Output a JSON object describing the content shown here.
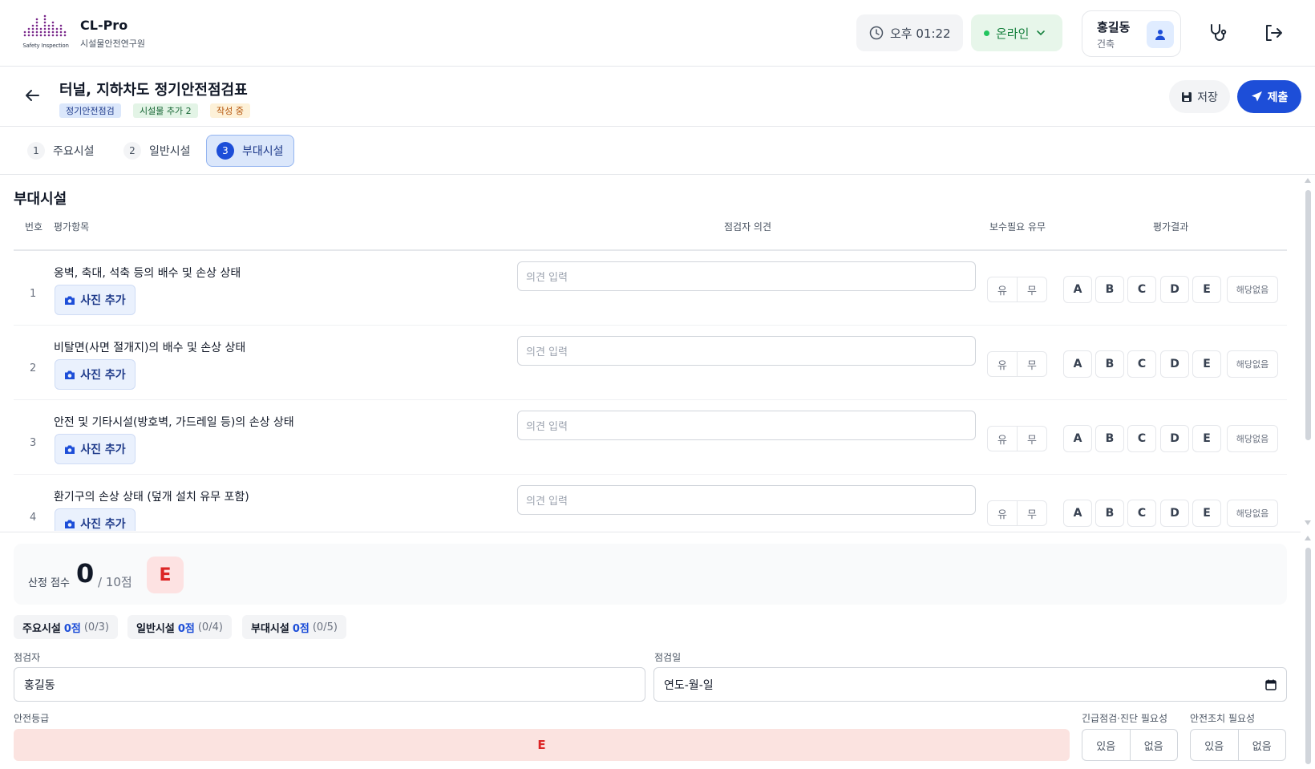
{
  "app": {
    "logo_caption": "Safety Inspection",
    "name": "CL-Pro",
    "subtitle": "시설물안전연구원"
  },
  "header": {
    "time": "오후 01:22",
    "status": "온라인",
    "user_name": "홍길동",
    "user_role": "건축"
  },
  "document": {
    "title": "터널, 지하차도 정기안전점검표",
    "tags": [
      "정기안전점검",
      "시설물 추가 2",
      "작성 중"
    ],
    "save_label": "저장",
    "submit_label": "제출"
  },
  "tabs": [
    {
      "num": "1",
      "label": "주요시설"
    },
    {
      "num": "2",
      "label": "일반시설"
    },
    {
      "num": "3",
      "label": "부대시설",
      "active": true
    }
  ],
  "section": {
    "title": "부대시설",
    "headers": {
      "num": "번호",
      "item": "평가항목",
      "opinion": "점검자 의견",
      "repair": "보수필요 유무",
      "result": "평가결과"
    },
    "photo_label": "사진 추가",
    "opinion_placeholder": "의견 입력",
    "yes": "유",
    "no": "무",
    "grades": [
      "A",
      "B",
      "C",
      "D",
      "E"
    ],
    "na": "해당없음",
    "rows": [
      {
        "num": "1",
        "label": "옹벽, 축대, 석축 등의 배수 및 손상 상태"
      },
      {
        "num": "2",
        "label": "비탈면(사면 절개지)의 배수 및 손상 상태"
      },
      {
        "num": "3",
        "label": "안전 및 기타시설(방호벽, 가드레일 등)의 손상 상태"
      },
      {
        "num": "4",
        "label": "환기구의 손상 상태 (덮개 설치 유무 포함)"
      }
    ]
  },
  "summary": {
    "score_label": "산정 점수",
    "score": "0",
    "score_max": "/ 10점",
    "grade": "E",
    "subs": [
      {
        "label": "주요시설",
        "points": "0점",
        "count": "(0/3)"
      },
      {
        "label": "일반시설",
        "points": "0점",
        "count": "(0/4)"
      },
      {
        "label": "부대시설",
        "points": "0점",
        "count": "(0/5)"
      }
    ],
    "inspector_label": "점검자",
    "inspector_value": "홍길동",
    "date_label": "점검일",
    "date_value": "연도-월-일",
    "safety_label": "안전등급",
    "safety_value": "E",
    "urgent_label": "긴급점검·진단 필요성",
    "measure_label": "안전조치 필요성",
    "have": "있음",
    "none": "없음"
  }
}
